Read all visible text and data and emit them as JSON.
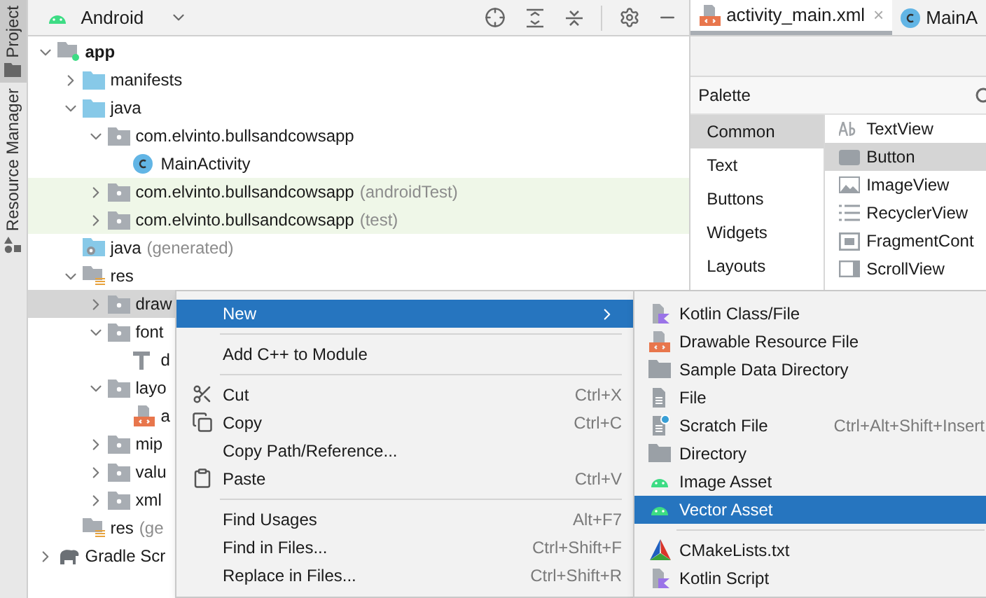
{
  "side_tabs": [
    {
      "label": "Project",
      "selected": true
    },
    {
      "label": "Resource Manager",
      "selected": false
    }
  ],
  "project_view": {
    "view_mode": "Android"
  },
  "tree": [
    {
      "kind": "module",
      "label": "app",
      "expanded": true,
      "selected": false,
      "children": [
        {
          "kind": "folder",
          "label": "manifests",
          "expanded": false,
          "selected": false
        },
        {
          "kind": "folder",
          "label": "java",
          "expanded": true,
          "selected": false,
          "children": [
            {
              "kind": "package",
              "label": "com.elvinto.bullsandcowsapp",
              "expanded": true,
              "selected": false,
              "children": [
                {
                  "kind": "class",
                  "label": "MainActivity",
                  "selected": false
                }
              ]
            },
            {
              "kind": "package",
              "label": "com.elvinto.bullsandcowsapp",
              "suffix": "(androidTest)",
              "test_source": true,
              "expanded": false,
              "selected": false
            },
            {
              "kind": "package",
              "label": "com.elvinto.bullsandcowsapp",
              "suffix": "(test)",
              "test_source": true,
              "expanded": false,
              "selected": false
            }
          ]
        },
        {
          "kind": "generated",
          "label": "java",
          "suffix": "(generated)",
          "selected": false
        },
        {
          "kind": "res",
          "label": "res",
          "expanded": true,
          "selected": false,
          "children": [
            {
              "kind": "package",
              "label": "draw",
              "expanded": false,
              "selected": true
            },
            {
              "kind": "package",
              "label": "font",
              "expanded": true,
              "selected": false,
              "children": [
                {
                  "kind": "font-file",
                  "label": "d",
                  "selected": false
                }
              ]
            },
            {
              "kind": "package",
              "label": "layo",
              "expanded": true,
              "selected": false,
              "children": [
                {
                  "kind": "layout-file",
                  "label": "a",
                  "selected": false
                }
              ]
            },
            {
              "kind": "package",
              "label": "mip",
              "expanded": false,
              "selected": false
            },
            {
              "kind": "package",
              "label": "valu",
              "expanded": false,
              "selected": false
            },
            {
              "kind": "package",
              "label": "xml",
              "expanded": false,
              "selected": false
            }
          ]
        },
        {
          "kind": "res",
          "label": "res",
          "suffix": "(ge",
          "selected": false
        }
      ]
    },
    {
      "kind": "gradle",
      "label": "Gradle Scr",
      "expanded": false,
      "selected": false
    }
  ],
  "editor_tabs": [
    {
      "kind": "layout-file",
      "label": "activity_main.xml",
      "close": "×",
      "selected": true
    },
    {
      "kind": "class",
      "label": "MainA",
      "selected": false
    }
  ],
  "palette": {
    "title": "Palette",
    "categories": [
      {
        "label": "Common",
        "selected": true
      },
      {
        "label": "Text",
        "selected": false
      },
      {
        "label": "Buttons",
        "selected": false
      },
      {
        "label": "Widgets",
        "selected": false
      },
      {
        "label": "Layouts",
        "selected": false
      }
    ],
    "items": [
      {
        "kind": "text",
        "label": "TextView",
        "selected": false
      },
      {
        "kind": "button",
        "label": "Button",
        "selected": true
      },
      {
        "kind": "image",
        "label": "ImageView",
        "selected": false
      },
      {
        "kind": "list",
        "label": "RecyclerView",
        "selected": false
      },
      {
        "kind": "fragment",
        "label": "FragmentCont",
        "selected": false
      },
      {
        "kind": "scroll",
        "label": "ScrollView",
        "selected": false
      }
    ]
  },
  "context_menu": [
    {
      "kind": "plain",
      "label": "New",
      "submenu": true,
      "selected": true
    },
    {
      "kind": "separator"
    },
    {
      "kind": "plain",
      "label": "Add C++ to Module",
      "selected": false
    },
    {
      "kind": "separator"
    },
    {
      "kind": "cut",
      "label": "Cut",
      "shortcut": "Ctrl+X",
      "selected": false
    },
    {
      "kind": "copy",
      "label": "Copy",
      "shortcut": "Ctrl+C",
      "selected": false
    },
    {
      "kind": "plain",
      "label": "Copy Path/Reference...",
      "selected": false
    },
    {
      "kind": "paste",
      "label": "Paste",
      "shortcut": "Ctrl+V",
      "selected": false
    },
    {
      "kind": "separator"
    },
    {
      "kind": "plain",
      "label": "Find Usages",
      "shortcut": "Alt+F7",
      "selected": false
    },
    {
      "kind": "plain",
      "label": "Find in Files...",
      "shortcut": "Ctrl+Shift+F",
      "selected": false
    },
    {
      "kind": "plain",
      "label": "Replace in Files...",
      "shortcut": "Ctrl+Shift+R",
      "selected": false
    }
  ],
  "submenu": [
    {
      "kind": "kotlin-file",
      "label": "Kotlin Class/File",
      "selected": false
    },
    {
      "kind": "drawable-file",
      "label": "Drawable Resource File",
      "selected": false
    },
    {
      "kind": "folder",
      "label": "Sample Data Directory",
      "selected": false
    },
    {
      "kind": "file",
      "label": "File",
      "selected": false
    },
    {
      "kind": "scratch-file",
      "label": "Scratch File",
      "shortcut": "Ctrl+Alt+Shift+Insert",
      "selected": false
    },
    {
      "kind": "folder",
      "label": "Directory",
      "selected": false
    },
    {
      "kind": "android",
      "label": "Image Asset",
      "selected": false
    },
    {
      "kind": "android",
      "label": "Vector Asset",
      "selected": true
    },
    {
      "kind": "separator"
    },
    {
      "kind": "cmake",
      "label": "CMakeLists.txt",
      "selected": false
    },
    {
      "kind": "kotlin-file",
      "label": "Kotlin Script",
      "selected": false
    }
  ]
}
